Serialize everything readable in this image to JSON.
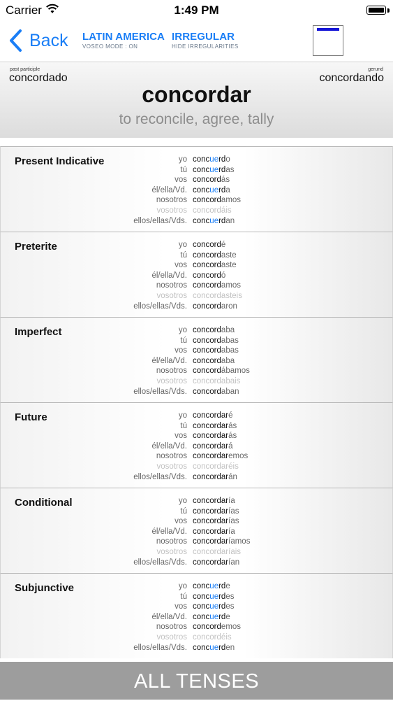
{
  "status_bar": {
    "carrier": "Carrier",
    "time": "1:49 PM"
  },
  "nav": {
    "back_label": "Back",
    "option1_title": "LATIN AMERICA",
    "option1_sub": "VOSEO MODE : ON",
    "option2_title": "IRREGULAR",
    "option2_sub": "HIDE IRREGULARITIES",
    "accent_color": "#1a7ef6",
    "thumb_bar_color": "#1515d6"
  },
  "header": {
    "past_participle_caption": "past participle",
    "past_participle": "concordado",
    "gerund_caption": "gerund",
    "gerund": "concordando",
    "infinitive": "concordar",
    "meaning": "to reconcile, agree, tally"
  },
  "tenses": [
    {
      "title": "Present Indicative",
      "rows": [
        {
          "pronoun": "yo",
          "parts": [
            [
              "conc",
              "s"
            ],
            [
              "ue",
              "i"
            ],
            [
              "rd",
              "s"
            ],
            [
              "o",
              "e"
            ]
          ]
        },
        {
          "pronoun": "tú",
          "parts": [
            [
              "conc",
              "s"
            ],
            [
              "ue",
              "i"
            ],
            [
              "rd",
              "s"
            ],
            [
              "as",
              "e"
            ]
          ]
        },
        {
          "pronoun": "vos",
          "parts": [
            [
              "concord",
              "s"
            ],
            [
              "ás",
              "e"
            ]
          ]
        },
        {
          "pronoun": "él/ella/Vd.",
          "parts": [
            [
              "conc",
              "s"
            ],
            [
              "ue",
              "i"
            ],
            [
              "rd",
              "s"
            ],
            [
              "a",
              "e"
            ]
          ]
        },
        {
          "pronoun": "nosotros",
          "parts": [
            [
              "concord",
              "s"
            ],
            [
              "amos",
              "e"
            ]
          ]
        },
        {
          "pronoun": "vosotros",
          "dim": true,
          "parts": [
            [
              "concord",
              "s"
            ],
            [
              "áis",
              "e"
            ]
          ]
        },
        {
          "pronoun": "ellos/ellas/Vds.",
          "parts": [
            [
              "conc",
              "s"
            ],
            [
              "ue",
              "i"
            ],
            [
              "rd",
              "s"
            ],
            [
              "an",
              "e"
            ]
          ]
        }
      ]
    },
    {
      "title": "Preterite",
      "rows": [
        {
          "pronoun": "yo",
          "parts": [
            [
              "concord",
              "s"
            ],
            [
              "é",
              "e"
            ]
          ]
        },
        {
          "pronoun": "tú",
          "parts": [
            [
              "concord",
              "s"
            ],
            [
              "aste",
              "e"
            ]
          ]
        },
        {
          "pronoun": "vos",
          "parts": [
            [
              "concord",
              "s"
            ],
            [
              "aste",
              "e"
            ]
          ]
        },
        {
          "pronoun": "él/ella/Vd.",
          "parts": [
            [
              "concord",
              "s"
            ],
            [
              "ó",
              "e"
            ]
          ]
        },
        {
          "pronoun": "nosotros",
          "parts": [
            [
              "concord",
              "s"
            ],
            [
              "amos",
              "e"
            ]
          ]
        },
        {
          "pronoun": "vosotros",
          "dim": true,
          "parts": [
            [
              "concord",
              "s"
            ],
            [
              "asteis",
              "e"
            ]
          ]
        },
        {
          "pronoun": "ellos/ellas/Vds.",
          "parts": [
            [
              "concord",
              "s"
            ],
            [
              "aron",
              "e"
            ]
          ]
        }
      ]
    },
    {
      "title": "Imperfect",
      "rows": [
        {
          "pronoun": "yo",
          "parts": [
            [
              "concord",
              "s"
            ],
            [
              "aba",
              "e"
            ]
          ]
        },
        {
          "pronoun": "tú",
          "parts": [
            [
              "concord",
              "s"
            ],
            [
              "abas",
              "e"
            ]
          ]
        },
        {
          "pronoun": "vos",
          "parts": [
            [
              "concord",
              "s"
            ],
            [
              "abas",
              "e"
            ]
          ]
        },
        {
          "pronoun": "él/ella/Vd.",
          "parts": [
            [
              "concord",
              "s"
            ],
            [
              "aba",
              "e"
            ]
          ]
        },
        {
          "pronoun": "nosotros",
          "parts": [
            [
              "concord",
              "s"
            ],
            [
              "ábamos",
              "e"
            ]
          ]
        },
        {
          "pronoun": "vosotros",
          "dim": true,
          "parts": [
            [
              "concord",
              "s"
            ],
            [
              "abais",
              "e"
            ]
          ]
        },
        {
          "pronoun": "ellos/ellas/Vds.",
          "parts": [
            [
              "concord",
              "s"
            ],
            [
              "aban",
              "e"
            ]
          ]
        }
      ]
    },
    {
      "title": "Future",
      "rows": [
        {
          "pronoun": "yo",
          "parts": [
            [
              "concordar",
              "s"
            ],
            [
              "é",
              "e"
            ]
          ]
        },
        {
          "pronoun": "tú",
          "parts": [
            [
              "concordar",
              "s"
            ],
            [
              "ás",
              "e"
            ]
          ]
        },
        {
          "pronoun": "vos",
          "parts": [
            [
              "concordar",
              "s"
            ],
            [
              "ás",
              "e"
            ]
          ]
        },
        {
          "pronoun": "él/ella/Vd.",
          "parts": [
            [
              "concordar",
              "s"
            ],
            [
              "á",
              "e"
            ]
          ]
        },
        {
          "pronoun": "nosotros",
          "parts": [
            [
              "concordar",
              "s"
            ],
            [
              "emos",
              "e"
            ]
          ]
        },
        {
          "pronoun": "vosotros",
          "dim": true,
          "parts": [
            [
              "concordar",
              "s"
            ],
            [
              "éis",
              "e"
            ]
          ]
        },
        {
          "pronoun": "ellos/ellas/Vds.",
          "parts": [
            [
              "concordar",
              "s"
            ],
            [
              "án",
              "e"
            ]
          ]
        }
      ]
    },
    {
      "title": "Conditional",
      "rows": [
        {
          "pronoun": "yo",
          "parts": [
            [
              "concordar",
              "s"
            ],
            [
              "ía",
              "e"
            ]
          ]
        },
        {
          "pronoun": "tú",
          "parts": [
            [
              "concordar",
              "s"
            ],
            [
              "ías",
              "e"
            ]
          ]
        },
        {
          "pronoun": "vos",
          "parts": [
            [
              "concordar",
              "s"
            ],
            [
              "ías",
              "e"
            ]
          ]
        },
        {
          "pronoun": "él/ella/Vd.",
          "parts": [
            [
              "concordar",
              "s"
            ],
            [
              "ía",
              "e"
            ]
          ]
        },
        {
          "pronoun": "nosotros",
          "parts": [
            [
              "concordar",
              "s"
            ],
            [
              "íamos",
              "e"
            ]
          ]
        },
        {
          "pronoun": "vosotros",
          "dim": true,
          "parts": [
            [
              "concordar",
              "s"
            ],
            [
              "íais",
              "e"
            ]
          ]
        },
        {
          "pronoun": "ellos/ellas/Vds.",
          "parts": [
            [
              "concordar",
              "s"
            ],
            [
              "ían",
              "e"
            ]
          ]
        }
      ]
    },
    {
      "title": "Subjunctive",
      "rows": [
        {
          "pronoun": "yo",
          "parts": [
            [
              "conc",
              "s"
            ],
            [
              "ue",
              "i"
            ],
            [
              "rd",
              "s"
            ],
            [
              "e",
              "e"
            ]
          ]
        },
        {
          "pronoun": "tú",
          "parts": [
            [
              "conc",
              "s"
            ],
            [
              "ue",
              "i"
            ],
            [
              "rd",
              "s"
            ],
            [
              "es",
              "e"
            ]
          ]
        },
        {
          "pronoun": "vos",
          "parts": [
            [
              "conc",
              "s"
            ],
            [
              "ue",
              "i"
            ],
            [
              "rd",
              "s"
            ],
            [
              "es",
              "e"
            ]
          ]
        },
        {
          "pronoun": "él/ella/Vd.",
          "parts": [
            [
              "conc",
              "s"
            ],
            [
              "ue",
              "i"
            ],
            [
              "rd",
              "s"
            ],
            [
              "e",
              "e"
            ]
          ]
        },
        {
          "pronoun": "nosotros",
          "parts": [
            [
              "concord",
              "s"
            ],
            [
              "emos",
              "e"
            ]
          ]
        },
        {
          "pronoun": "vosotros",
          "dim": true,
          "parts": [
            [
              "concord",
              "s"
            ],
            [
              "éis",
              "e"
            ]
          ]
        },
        {
          "pronoun": "ellos/ellas/Vds.",
          "parts": [
            [
              "conc",
              "s"
            ],
            [
              "ue",
              "i"
            ],
            [
              "rd",
              "s"
            ],
            [
              "en",
              "e"
            ]
          ]
        }
      ]
    }
  ],
  "footer": {
    "label": "ALL TENSES"
  }
}
